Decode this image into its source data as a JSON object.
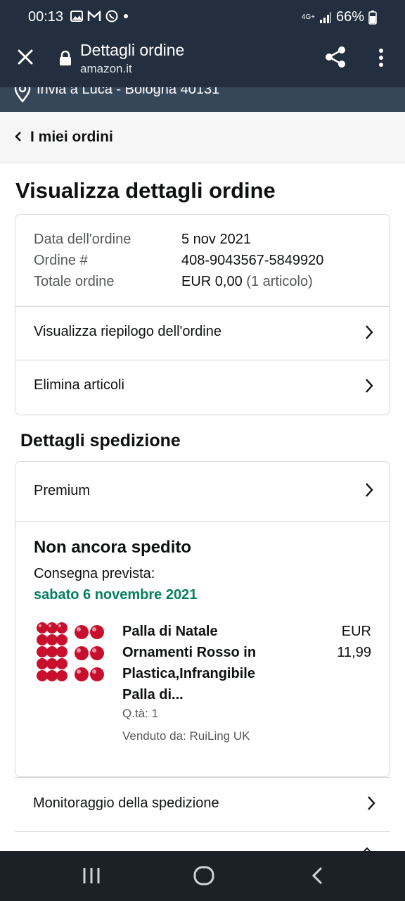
{
  "status_bar": {
    "time": "00:13",
    "network": "4G+",
    "battery": "66%"
  },
  "app_bar": {
    "title": "Dettagli ordine",
    "url": "amazon.it"
  },
  "delivery": {
    "text": "Invia a Luca - Bologna 40131"
  },
  "breadcrumb": {
    "label": "I miei ordini"
  },
  "page_title": "Visualizza dettagli ordine",
  "order": {
    "date_label": "Data dell'ordine",
    "date_value": "5 nov 2021",
    "number_label": "Ordine #",
    "number_value": "408-9043567-5849920",
    "total_label": "Totale ordine",
    "total_value": "EUR 0,00",
    "total_items": "(1 articolo)"
  },
  "order_links": {
    "summary": "Visualizza riepilogo dell'ordine",
    "delete": "Elimina articoli"
  },
  "shipping": {
    "section_title": "Dettagli spedizione",
    "method": "Premium",
    "status": "Non ancora spedito",
    "estimate_label": "Consegna prevista:",
    "estimate_date": "sabato 6 novembre 2021",
    "item": {
      "name": "Palla di Natale Ornamenti Rosso in Plastica,Infrangibile Palla di...",
      "price_currency": "EUR",
      "price_value": "11,99",
      "quantity": "Q.tà: 1",
      "seller": "Venduto da: RuiLing UK"
    }
  },
  "tracking_label": "Monitoraggio della spedizione",
  "colors": {
    "header": "#232f3e",
    "subheader": "#37475a",
    "green": "#067d62"
  }
}
